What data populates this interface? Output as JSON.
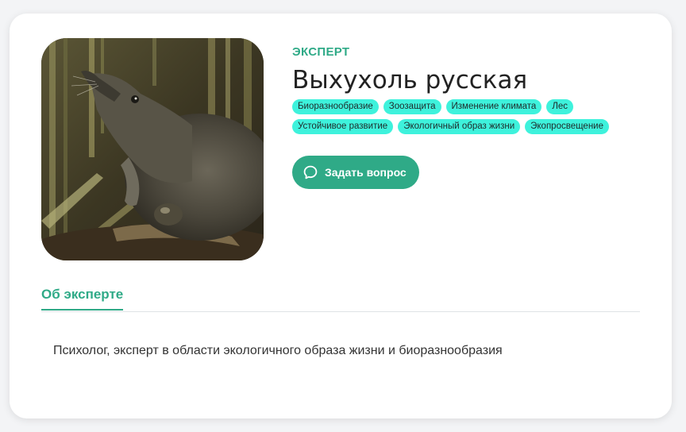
{
  "expert": {
    "label": "ЭКСПЕРТ",
    "name": "Выхухоль русская",
    "photo_icon": "muskrat-photo",
    "tags": [
      "Биоразнообразие",
      "Зоозащита",
      "Изменение климата",
      "Лес",
      "Устойчивое развитие",
      "Экологичный образ жизни",
      "Экопросвещение"
    ]
  },
  "actions": {
    "ask_label": "Задать вопрос",
    "ask_icon": "speech-bubble-icon"
  },
  "tabs": [
    {
      "label": "Об эксперте",
      "active": true
    }
  ],
  "about": {
    "text": "Психолог, эксперт в области экологичного образа жизни и биоразнообразия"
  },
  "colors": {
    "accent": "#2faa87",
    "tag_bg": "#3ef2dc",
    "text": "#222222"
  }
}
